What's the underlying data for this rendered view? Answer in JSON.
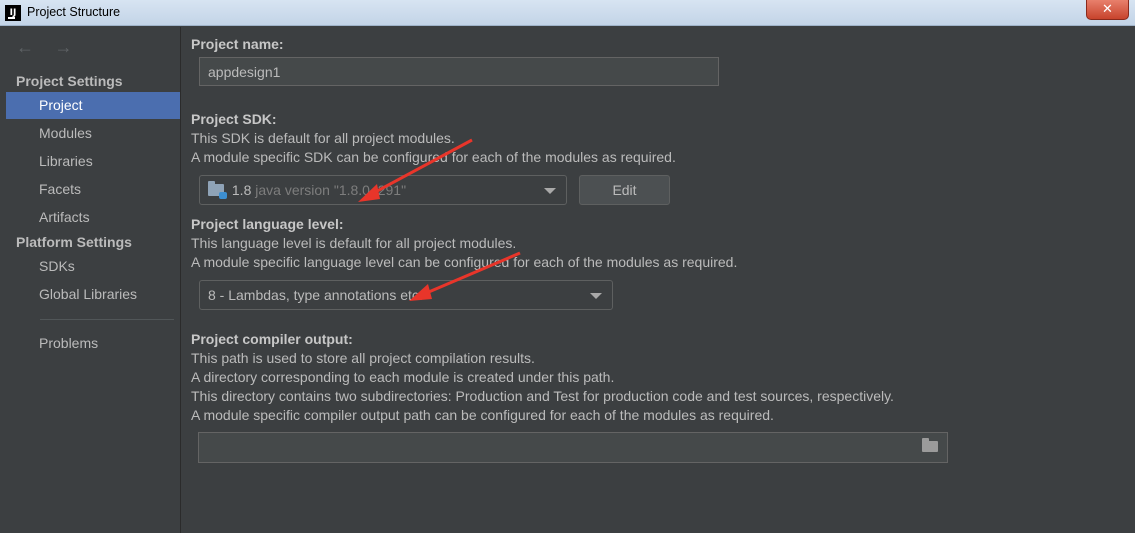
{
  "window": {
    "title": "Project Structure",
    "app_icon_label": "IJ",
    "close_glyph": "✕"
  },
  "sidebar": {
    "back_glyph": "←",
    "forward_glyph": "→",
    "project_settings_header": "Project Settings",
    "project_settings_items": [
      "Project",
      "Modules",
      "Libraries",
      "Facets",
      "Artifacts"
    ],
    "platform_settings_header": "Platform Settings",
    "platform_settings_items": [
      "SDKs",
      "Global Libraries"
    ],
    "problems_label": "Problems",
    "selected_item": "Project"
  },
  "main": {
    "project_name": {
      "label": "Project name:",
      "value": "appdesign1"
    },
    "project_sdk": {
      "label": "Project SDK:",
      "desc_line1": "This SDK is default for all project modules.",
      "desc_line2": "A module specific SDK can be configured for each of the modules as required.",
      "selected_name": "1.8",
      "selected_version": "java version \"1.8.0_291\"",
      "edit_button": "Edit"
    },
    "language_level": {
      "label": "Project language level:",
      "desc_line1": "This language level is default for all project modules.",
      "desc_line2": "A module specific language level can be configured for each of the modules as required.",
      "selected": "8 - Lambdas, type annotations etc."
    },
    "compiler_output": {
      "label": "Project compiler output:",
      "desc_line1": "This path is used to store all project compilation results.",
      "desc_line2": "A directory corresponding to each module is created under this path.",
      "desc_line3": "This directory contains two subdirectories: Production and Test for production code and test sources, respectively.",
      "desc_line4": "A module specific compiler output path can be configured for each of the modules as required.",
      "value": ""
    }
  },
  "colors": {
    "background": "#3c3f41",
    "selection": "#4b6eaf",
    "annotation_arrow": "#e8352a"
  }
}
